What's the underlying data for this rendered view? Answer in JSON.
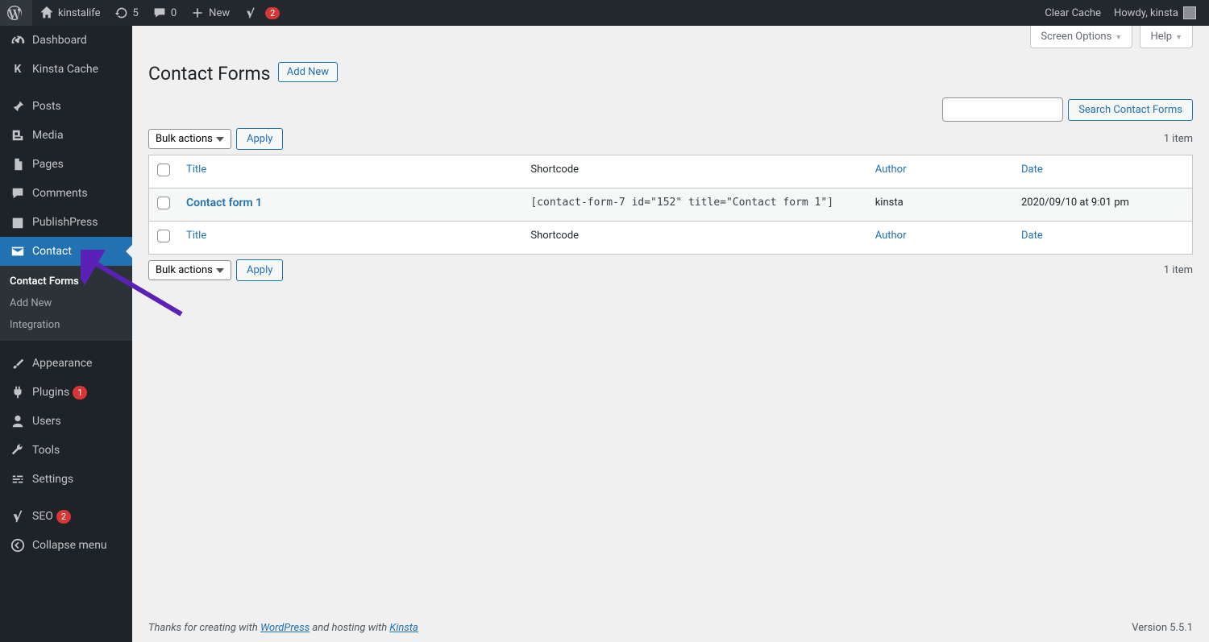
{
  "adminbar": {
    "site_name": "kinstalife",
    "updates": "5",
    "comments": "0",
    "new": "New",
    "yoast_badge": "2",
    "clear_cache": "Clear Cache",
    "howdy": "Howdy, kinsta"
  },
  "menu": {
    "dashboard": "Dashboard",
    "kinsta_cache": "Kinsta Cache",
    "posts": "Posts",
    "media": "Media",
    "pages": "Pages",
    "comments": "Comments",
    "publishpress": "PublishPress",
    "contact": "Contact",
    "appearance": "Appearance",
    "plugins": "Plugins",
    "plugins_badge": "1",
    "users": "Users",
    "tools": "Tools",
    "settings": "Settings",
    "seo": "SEO",
    "seo_badge": "2",
    "collapse": "Collapse menu"
  },
  "submenu": {
    "contact_forms": "Contact Forms",
    "add_new": "Add New",
    "integration": "Integration"
  },
  "screen_meta": {
    "screen_options": "Screen Options",
    "help": "Help"
  },
  "page": {
    "title": "Contact Forms",
    "add_new": "Add New",
    "search_button": "Search Contact Forms",
    "bulk_actions": "Bulk actions",
    "apply": "Apply",
    "item_count": "1 item"
  },
  "columns": {
    "title": "Title",
    "shortcode": "Shortcode",
    "author": "Author",
    "date": "Date"
  },
  "rows": [
    {
      "title": "Contact form 1",
      "shortcode": "[contact-form-7 id=\"152\" title=\"Contact form 1\"]",
      "author": "kinsta",
      "date": "2020/09/10 at 9:01 pm"
    }
  ],
  "footer": {
    "thanks_prefix": "Thanks for creating with ",
    "wordpress": "WordPress",
    "thanks_mid": " and hosting with ",
    "kinsta": "Kinsta",
    "version": "Version 5.5.1"
  }
}
